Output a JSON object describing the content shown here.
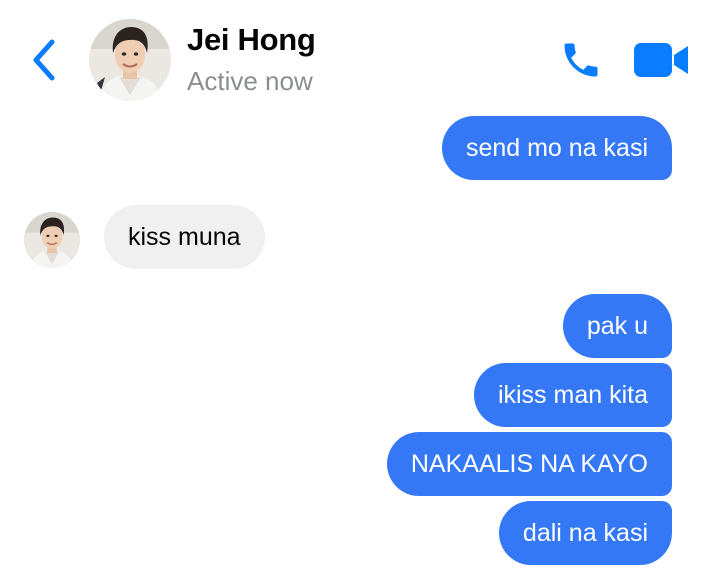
{
  "header": {
    "contact_name": "Jei Hong",
    "status": "Active now",
    "back_icon": "chevron-left-icon",
    "call_icon": "phone-icon",
    "video_icon": "video-camera-icon"
  },
  "colors": {
    "accent": "#0a7cff",
    "outgoing_bubble": "#3578f6",
    "incoming_bubble": "#f0f0f0",
    "status_text": "#8a8d91"
  },
  "messages": [
    {
      "direction": "outgoing",
      "text": "send mo na kasi"
    },
    {
      "direction": "incoming",
      "text": "kiss muna"
    },
    {
      "direction": "outgoing",
      "text": "pak u"
    },
    {
      "direction": "outgoing",
      "text": "ikiss man kita"
    },
    {
      "direction": "outgoing",
      "text": "NAKAALIS NA KAYO"
    },
    {
      "direction": "outgoing",
      "text": "dali na kasi"
    }
  ]
}
